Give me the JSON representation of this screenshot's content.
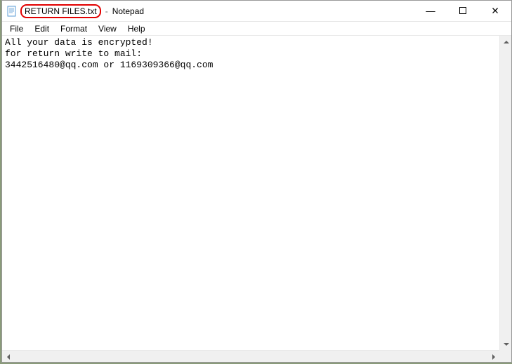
{
  "titlebar": {
    "filename": "RETURN FILES.txt",
    "separator": "-",
    "app_name": "Notepad"
  },
  "menubar": {
    "items": [
      "File",
      "Edit",
      "Format",
      "View",
      "Help"
    ]
  },
  "content": {
    "text": "All your data is encrypted!\nfor return write to mail:\n3442516480@qq.com or 1169309366@qq.com"
  },
  "icons": {
    "minimize": "—",
    "close": "✕"
  }
}
